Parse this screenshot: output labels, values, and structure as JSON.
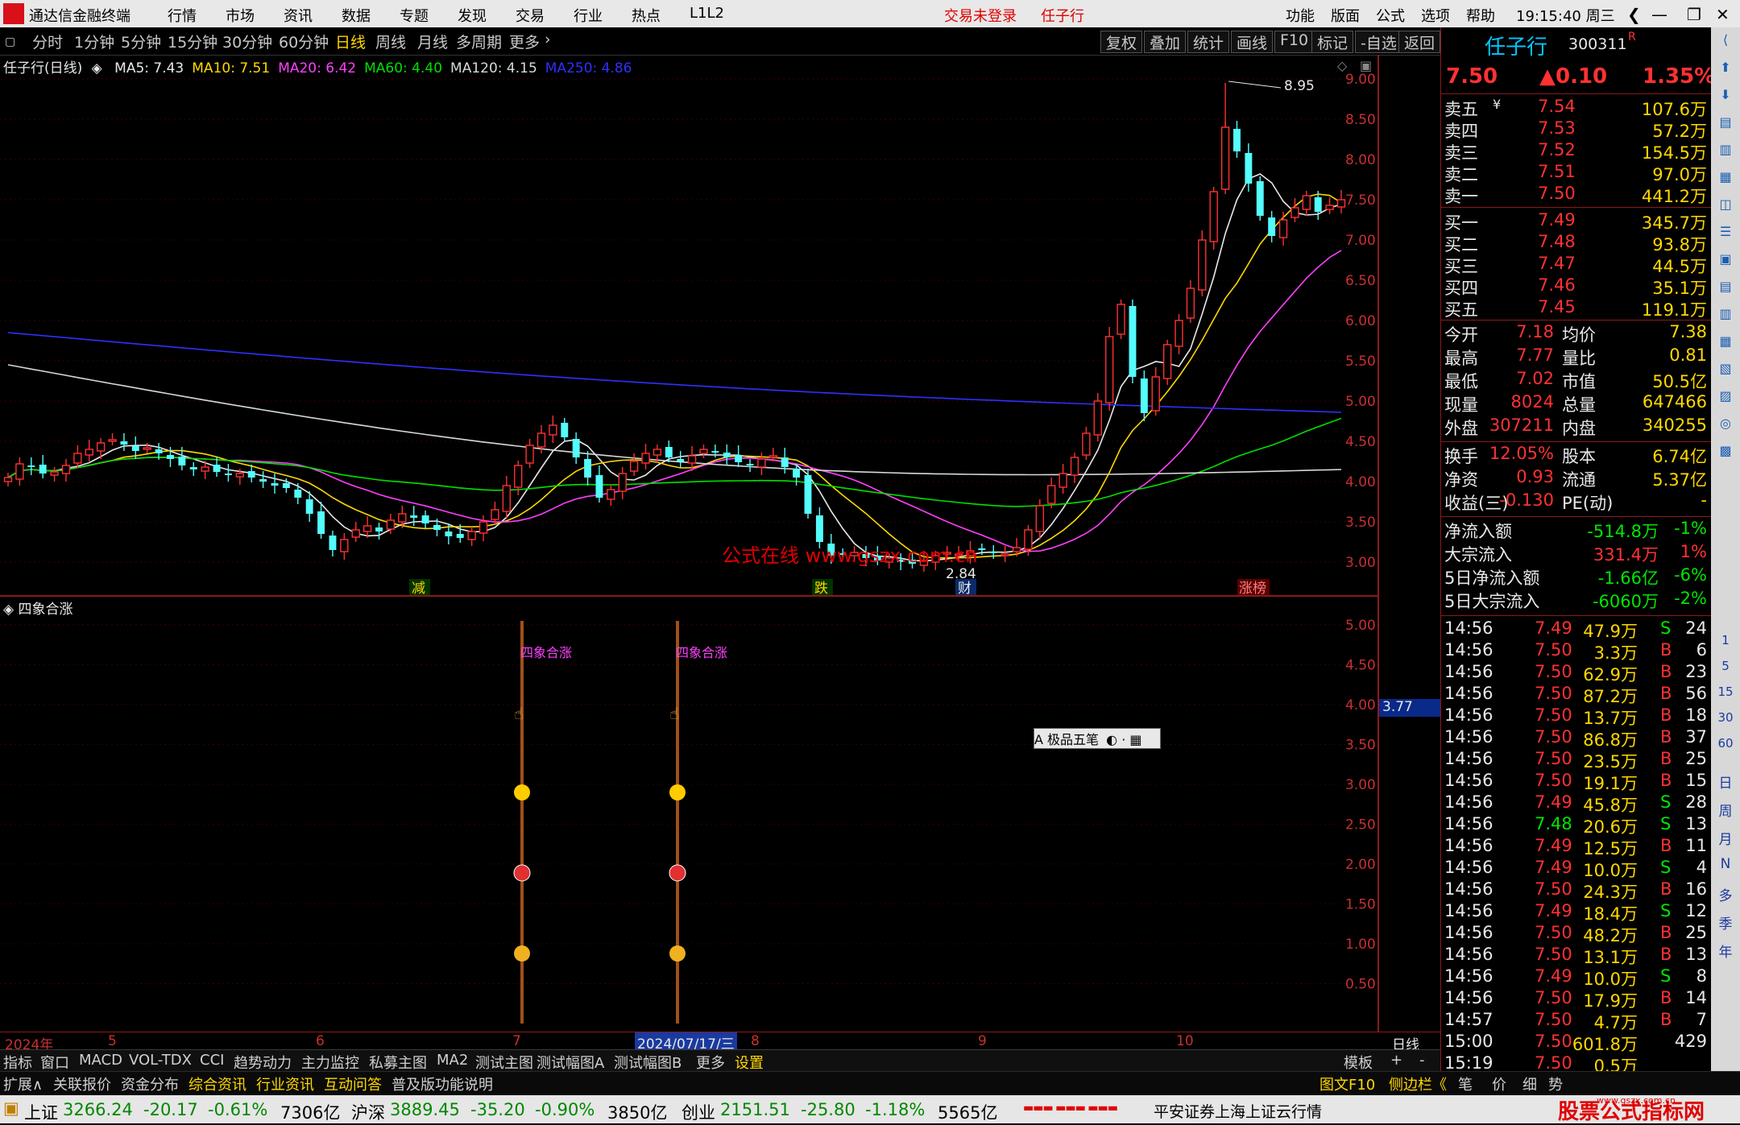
{
  "app": {
    "title": "通达信金融终端",
    "menu": [
      "行情",
      "市场",
      "资讯",
      "数据",
      "专题",
      "发现",
      "交易",
      "行业",
      "热点",
      "L1L2"
    ],
    "login_status": "交易未登录",
    "stock_short": "任子行",
    "right_menu": [
      "功能",
      "版面",
      "公式",
      "选项",
      "帮助"
    ],
    "clock": "19:15:40 周三"
  },
  "periods": {
    "items": [
      "分时",
      "1分钟",
      "5分钟",
      "15分钟",
      "30分钟",
      "60分钟",
      "日线",
      "周线",
      "月线",
      "多周期",
      "更多"
    ],
    "active": "日线",
    "tools": [
      "复权",
      "叠加",
      "统计",
      "画线",
      "F10",
      "标记",
      "-自选",
      "返回"
    ]
  },
  "ma_legend": {
    "title": "任子行(日线)",
    "items": [
      {
        "text": "MA5: 7.43",
        "color": "#e8e8e8"
      },
      {
        "text": "MA10: 7.51",
        "color": "#ffd800"
      },
      {
        "text": "MA20: 6.42",
        "color": "#ff40ff"
      },
      {
        "text": "MA60: 4.40",
        "color": "#00e000"
      },
      {
        "text": "MA120: 4.15",
        "color": "#d8d8d8"
      },
      {
        "text": "MA250: 4.86",
        "color": "#3030ff"
      }
    ]
  },
  "main_axis": [
    "9.00",
    "8.50",
    "8.00",
    "7.50",
    "7.00",
    "6.50",
    "6.00",
    "5.50",
    "5.00",
    "4.50",
    "4.00",
    "3.50",
    "3.00"
  ],
  "main_annotations": {
    "high": "8.95",
    "low": "2.84",
    "watermark": "公式在线  www.gszx.com.cn",
    "tags": [
      "减",
      "跌",
      "财",
      "涨榜"
    ]
  },
  "sub_chart": {
    "title": "四象合涨",
    "signal_label": "四象合涨",
    "axis": [
      "5.00",
      "4.50",
      "4.00",
      "3.50",
      "3.00",
      "2.50",
      "2.00",
      "1.50",
      "1.00",
      "0.50"
    ],
    "current_value": "3.77",
    "ime": "A 极品五笔"
  },
  "date_axis": {
    "labels": [
      "2024年",
      "5",
      "6",
      "7",
      "2024/07/17/三",
      "8",
      "9",
      "10"
    ],
    "period_label": "日线"
  },
  "chart_data": {
    "type": "candlestick",
    "title": "任子行(日线)",
    "ylim": [
      2.8,
      9.1
    ],
    "x_months": [
      "2024-04",
      "2024-05",
      "2024-06",
      "2024-07",
      "2024-08",
      "2024-09",
      "2024-10"
    ],
    "close": [
      4.05,
      4.22,
      4.18,
      4.1,
      4.12,
      4.2,
      4.35,
      4.4,
      4.48,
      4.52,
      4.46,
      4.38,
      4.42,
      4.35,
      4.28,
      4.2,
      4.15,
      4.18,
      4.12,
      4.08,
      4.1,
      4.05,
      4.0,
      3.95,
      3.92,
      3.8,
      3.6,
      3.35,
      3.15,
      3.28,
      3.4,
      3.45,
      3.38,
      3.52,
      3.6,
      3.55,
      3.48,
      3.4,
      3.32,
      3.3,
      3.38,
      3.5,
      3.65,
      3.95,
      4.2,
      4.45,
      4.6,
      4.7,
      4.55,
      4.3,
      4.05,
      3.8,
      3.9,
      4.1,
      4.25,
      4.35,
      4.4,
      4.3,
      4.25,
      4.32,
      4.4,
      4.38,
      4.3,
      4.24,
      4.2,
      4.28,
      4.32,
      4.18,
      4.05,
      3.6,
      3.25,
      3.08,
      3.1,
      3.12,
      3.05,
      3.02,
      3.05,
      3.0,
      2.98,
      3.02,
      3.08,
      3.12,
      3.1,
      3.14,
      3.15,
      3.12,
      3.1,
      3.18,
      3.4,
      3.7,
      3.95,
      4.1,
      4.3,
      4.6,
      5.0,
      5.8,
      6.2,
      5.3,
      4.85,
      5.3,
      5.7,
      6.0,
      6.4,
      7.0,
      7.6,
      8.4,
      8.1,
      7.7,
      7.3,
      7.05,
      7.25,
      7.4,
      7.55,
      7.35,
      7.43,
      7.5
    ],
    "ma_latest": {
      "MA5": 7.43,
      "MA10": 7.51,
      "MA20": 6.42,
      "MA60": 4.4,
      "MA120": 4.15,
      "MA250": 4.86
    },
    "high_mark": 8.95,
    "low_mark": 2.84,
    "sub_signal_days": [
      "2024-07-04",
      "2024-07-18"
    ]
  },
  "quote": {
    "name": "任子行",
    "code": "300311",
    "suffix": "R",
    "price": "7.50",
    "change": "▲0.10",
    "pct": "1.35%",
    "asks": [
      {
        "label": "卖五",
        "price": "7.54",
        "vol": "107.6万"
      },
      {
        "label": "卖四",
        "price": "7.53",
        "vol": "57.2万"
      },
      {
        "label": "卖三",
        "price": "7.52",
        "vol": "154.5万"
      },
      {
        "label": "卖二",
        "price": "7.51",
        "vol": "97.0万"
      },
      {
        "label": "卖一",
        "price": "7.50",
        "vol": "441.2万"
      }
    ],
    "bids": [
      {
        "label": "买一",
        "price": "7.49",
        "vol": "345.7万"
      },
      {
        "label": "买二",
        "price": "7.48",
        "vol": "93.8万"
      },
      {
        "label": "买三",
        "price": "7.47",
        "vol": "44.5万"
      },
      {
        "label": "买四",
        "price": "7.46",
        "vol": "35.1万"
      },
      {
        "label": "买五",
        "price": "7.45",
        "vol": "119.1万"
      }
    ],
    "ask_currency": "¥",
    "stats": [
      {
        "l1": "今开",
        "v1": "7.18",
        "l2": "均价",
        "v2": "7.38"
      },
      {
        "l1": "最高",
        "v1": "7.77",
        "l2": "量比",
        "v2": "0.81"
      },
      {
        "l1": "最低",
        "v1": "7.02",
        "l2": "市值",
        "v2": "50.5亿"
      },
      {
        "l1": "现量",
        "v1": "8024",
        "l2": "总量",
        "v2": "647466"
      },
      {
        "l1": "外盘",
        "v1": "307211",
        "l2": "内盘",
        "v2": "340255"
      }
    ],
    "stats2": [
      {
        "l1": "换手",
        "v1": "12.05%",
        "l2": "股本",
        "v2": "6.74亿"
      },
      {
        "l1": "净资",
        "v1": "0.93",
        "l2": "流通",
        "v2": "5.37亿"
      },
      {
        "l1": "收益(三)",
        "v1": "-0.130",
        "l2": "PE(动)",
        "v2": "-"
      }
    ],
    "flows": [
      {
        "label": "净流入额",
        "value": "-514.8万",
        "pct": "-1%"
      },
      {
        "label": "大宗流入",
        "value": "331.4万",
        "pct": "1%"
      },
      {
        "label": "5日净流入额",
        "value": "-1.66亿",
        "pct": "-6%"
      },
      {
        "label": "5日大宗流入",
        "value": "-6060万",
        "pct": "-2%"
      }
    ],
    "ticks": [
      {
        "t": "14:56",
        "p": "7.49",
        "v": "47.9万",
        "s": "S",
        "n": "24"
      },
      {
        "t": "14:56",
        "p": "7.50",
        "v": "3.3万",
        "s": "B",
        "n": "6"
      },
      {
        "t": "14:56",
        "p": "7.50",
        "v": "62.9万",
        "s": "B",
        "n": "23"
      },
      {
        "t": "14:56",
        "p": "7.50",
        "v": "87.2万",
        "s": "B",
        "n": "56"
      },
      {
        "t": "14:56",
        "p": "7.50",
        "v": "13.7万",
        "s": "B",
        "n": "18"
      },
      {
        "t": "14:56",
        "p": "7.50",
        "v": "86.8万",
        "s": "B",
        "n": "37"
      },
      {
        "t": "14:56",
        "p": "7.50",
        "v": "23.5万",
        "s": "B",
        "n": "25"
      },
      {
        "t": "14:56",
        "p": "7.50",
        "v": "19.1万",
        "s": "B",
        "n": "15"
      },
      {
        "t": "14:56",
        "p": "7.49",
        "v": "45.8万",
        "s": "S",
        "n": "28"
      },
      {
        "t": "14:56",
        "p": "7.48",
        "v": "20.6万",
        "s": "S",
        "n": "13"
      },
      {
        "t": "14:56",
        "p": "7.49",
        "v": "12.5万",
        "s": "B",
        "n": "11"
      },
      {
        "t": "14:56",
        "p": "7.49",
        "v": "10.0万",
        "s": "S",
        "n": "4"
      },
      {
        "t": "14:56",
        "p": "7.50",
        "v": "24.3万",
        "s": "B",
        "n": "16"
      },
      {
        "t": "14:56",
        "p": "7.49",
        "v": "18.4万",
        "s": "S",
        "n": "12"
      },
      {
        "t": "14:56",
        "p": "7.50",
        "v": "48.2万",
        "s": "B",
        "n": "25"
      },
      {
        "t": "14:56",
        "p": "7.50",
        "v": "13.1万",
        "s": "B",
        "n": "13"
      },
      {
        "t": "14:56",
        "p": "7.49",
        "v": "10.0万",
        "s": "S",
        "n": "8"
      },
      {
        "t": "14:56",
        "p": "7.50",
        "v": "17.9万",
        "s": "B",
        "n": "14"
      },
      {
        "t": "14:57",
        "p": "7.50",
        "v": "4.7万",
        "s": "B",
        "n": "7"
      },
      {
        "t": "15:00",
        "p": "7.50",
        "v": "601.8万",
        "s": "",
        "n": "429"
      },
      {
        "t": "15:19",
        "p": "7.50",
        "v": "0.5万",
        "s": "",
        "n": ""
      }
    ]
  },
  "side_icons": [
    "日",
    "周",
    "月",
    "N",
    "多",
    "季",
    "年"
  ],
  "side_nums": [
    "1",
    "5",
    "15",
    "30",
    "60"
  ],
  "tabs": [
    "指标",
    "窗口",
    "MACD",
    "VOL-TDX",
    "CCI",
    "趋势动力",
    "主力监控",
    "私募主图",
    "MA2",
    "测试主图",
    "测试幅图A",
    "测试幅图B",
    "更多",
    "设置"
  ],
  "tabs_right": [
    "模板",
    "+",
    "-"
  ],
  "tabs2": [
    "扩展∧",
    "关联报价",
    "资金分布",
    "综合资讯",
    "行业资讯",
    "互动问答",
    "普及版功能说明"
  ],
  "tabs2_right": [
    "图文F10",
    "侧边栏《",
    "笔",
    "价",
    "细",
    "势"
  ],
  "status": {
    "indices": [
      {
        "name": "上证",
        "val": "3266.24",
        "chg": "-20.17",
        "pct": "-0.61%",
        "amt": "7306亿"
      },
      {
        "name": "沪深",
        "val": "3889.45",
        "chg": "-35.20",
        "pct": "-0.90%",
        "amt": "3850亿"
      },
      {
        "name": "创业",
        "val": "2151.51",
        "chg": "-25.80",
        "pct": "-1.18%",
        "amt": "5565亿"
      }
    ],
    "server": "平安证券上海上证云行情",
    "brand": "股票公式指标网",
    "brand_url": "www.gszx.com.cn"
  }
}
